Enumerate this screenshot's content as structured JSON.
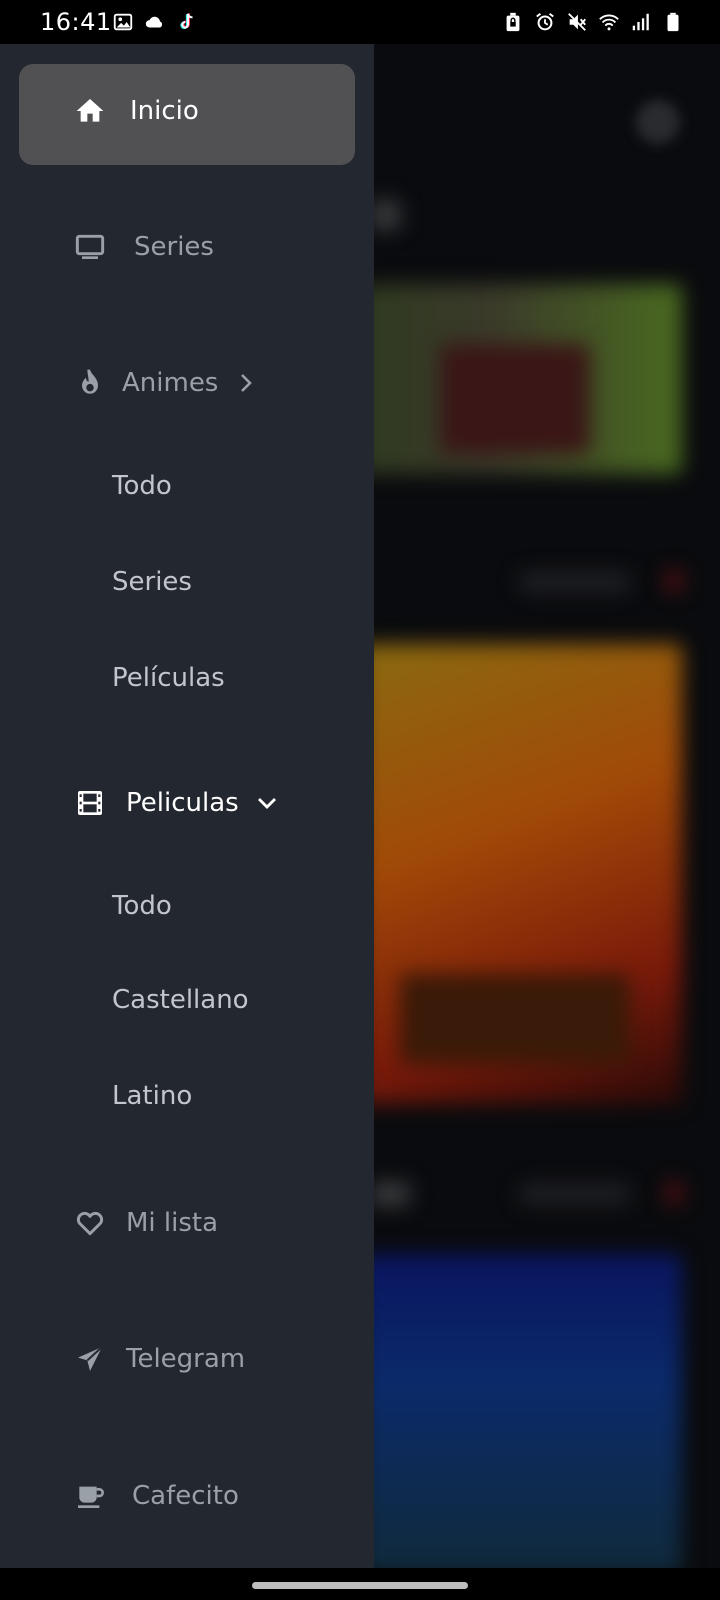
{
  "status_bar": {
    "time": "16:41",
    "left_icons": [
      "gallery-icon",
      "cloud-icon",
      "tiktok-icon"
    ],
    "right_icons": [
      "lock-battery-icon",
      "alarm-icon",
      "mute-icon",
      "wifi-icon",
      "signal-icon",
      "battery-icon"
    ]
  },
  "drawer": {
    "items": [
      {
        "label": "Inicio",
        "icon": "home-icon",
        "active": true
      },
      {
        "label": "Series",
        "icon": "tv-icon"
      },
      {
        "label": "Animes",
        "icon": "fire-icon",
        "expanded": false,
        "children": [
          "Todo",
          "Series",
          "Películas"
        ]
      },
      {
        "label": "Peliculas",
        "icon": "film-icon",
        "expanded": true,
        "children": [
          "Todo",
          "Castellano",
          "Latino"
        ]
      },
      {
        "label": "Mi lista",
        "icon": "heart-icon"
      },
      {
        "label": "Telegram",
        "icon": "send-icon"
      },
      {
        "label": "Cafecito",
        "icon": "coffee-icon"
      }
    ]
  },
  "colors": {
    "drawer_bg": "#23272f",
    "active_bg": "#515154",
    "inactive_text": "#9aa0a8",
    "active_text": "#ffffff",
    "sub_text": "#c2c6cc"
  }
}
